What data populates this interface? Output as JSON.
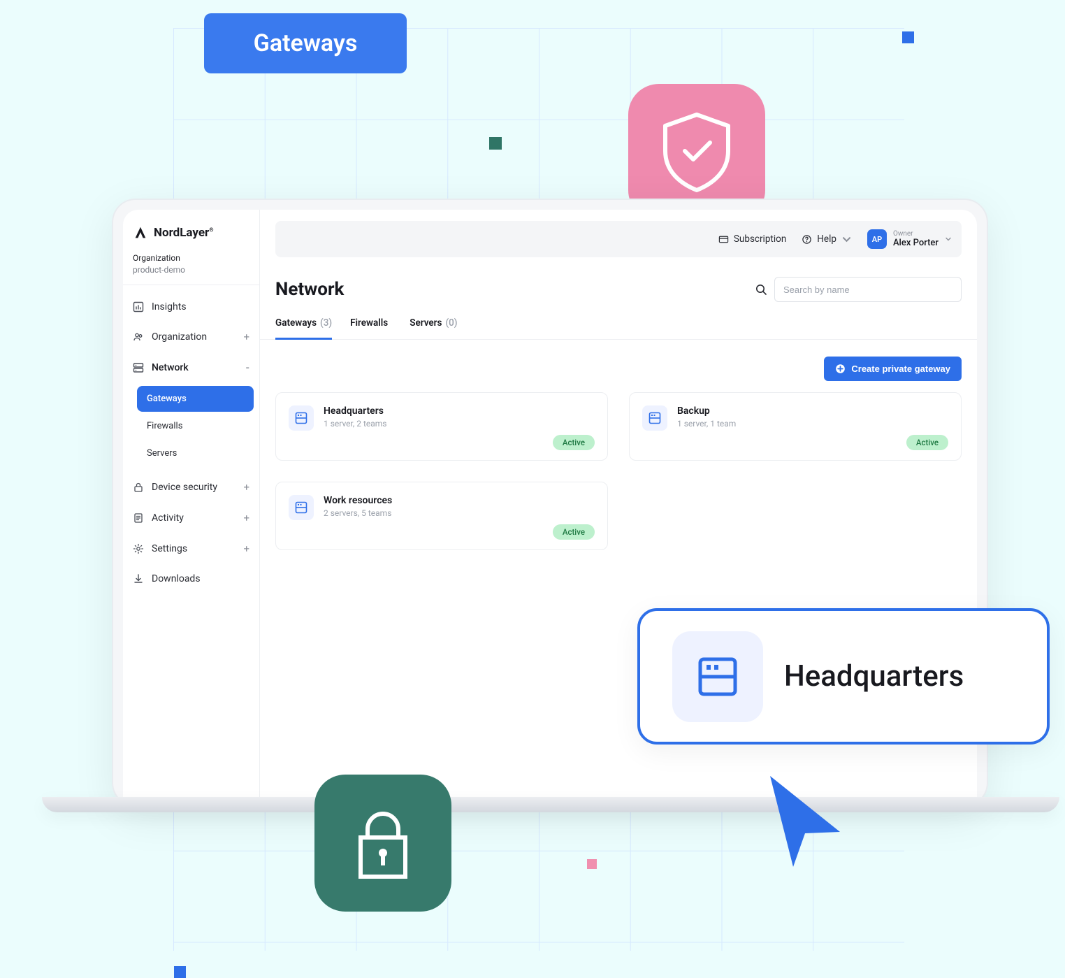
{
  "decor": {
    "float_label": "Gateways",
    "callout_label": "Headquarters"
  },
  "brand": {
    "name": "NordLayer"
  },
  "org": {
    "label": "Organization",
    "name": "product-demo"
  },
  "sidebar": {
    "items": [
      {
        "label": "Insights"
      },
      {
        "label": "Organization",
        "expand": "+"
      },
      {
        "label": "Network",
        "expand": "-"
      },
      {
        "label": "Device security",
        "expand": "+"
      },
      {
        "label": "Activity",
        "expand": "+"
      },
      {
        "label": "Settings",
        "expand": "+"
      },
      {
        "label": "Downloads"
      }
    ],
    "subnav": [
      {
        "label": "Gateways"
      },
      {
        "label": "Firewalls"
      },
      {
        "label": "Servers"
      }
    ]
  },
  "topbar": {
    "subscription": "Subscription",
    "help": "Help",
    "user": {
      "initials": "AP",
      "role": "Owner",
      "name": "Alex Porter"
    }
  },
  "page": {
    "title": "Network",
    "search_placeholder": "Search by name"
  },
  "tabs": [
    {
      "label": "Gateways",
      "count": "(3)"
    },
    {
      "label": "Firewalls",
      "count": ""
    },
    {
      "label": "Servers",
      "count": "(0)"
    }
  ],
  "actions": {
    "create": "Create private gateway"
  },
  "gateways": [
    {
      "name": "Headquarters",
      "sub": "1 server, 2 teams",
      "status": "Active"
    },
    {
      "name": "Backup",
      "sub": "1 server, 1 team",
      "status": "Active"
    },
    {
      "name": "Work resources",
      "sub": "2 servers, 5 teams",
      "status": "Active"
    }
  ]
}
